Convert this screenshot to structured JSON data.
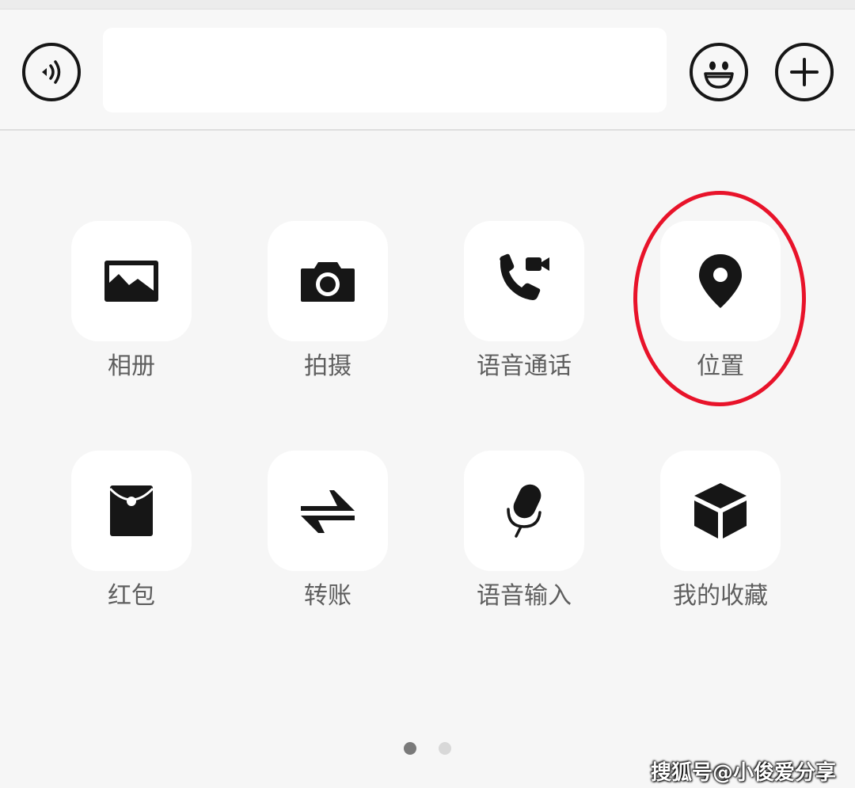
{
  "input_bar": {
    "voice_icon": "voice-input-icon",
    "emoji_icon": "emoji-icon",
    "plus_icon": "plus-icon",
    "text_value": ""
  },
  "panel": {
    "items": [
      {
        "label": "相册",
        "icon": "photo-album-icon"
      },
      {
        "label": "拍摄",
        "icon": "camera-icon"
      },
      {
        "label": "语音通话",
        "icon": "voice-call-icon"
      },
      {
        "label": "位置",
        "icon": "location-pin-icon"
      },
      {
        "label": "红包",
        "icon": "red-packet-icon"
      },
      {
        "label": "转账",
        "icon": "transfer-icon"
      },
      {
        "label": "语音输入",
        "icon": "microphone-icon"
      },
      {
        "label": "我的收藏",
        "icon": "favorites-icon"
      }
    ],
    "page_count": 2,
    "current_page": 1
  },
  "annotation": {
    "highlight_color": "#e8132a",
    "highlighted_item": "位置"
  },
  "watermark": "搜狐号@小俊爱分享",
  "colors": {
    "icon": "#161616",
    "label": "#5e5e5e",
    "tile": "#ffffff",
    "background": "#f6f6f6"
  }
}
